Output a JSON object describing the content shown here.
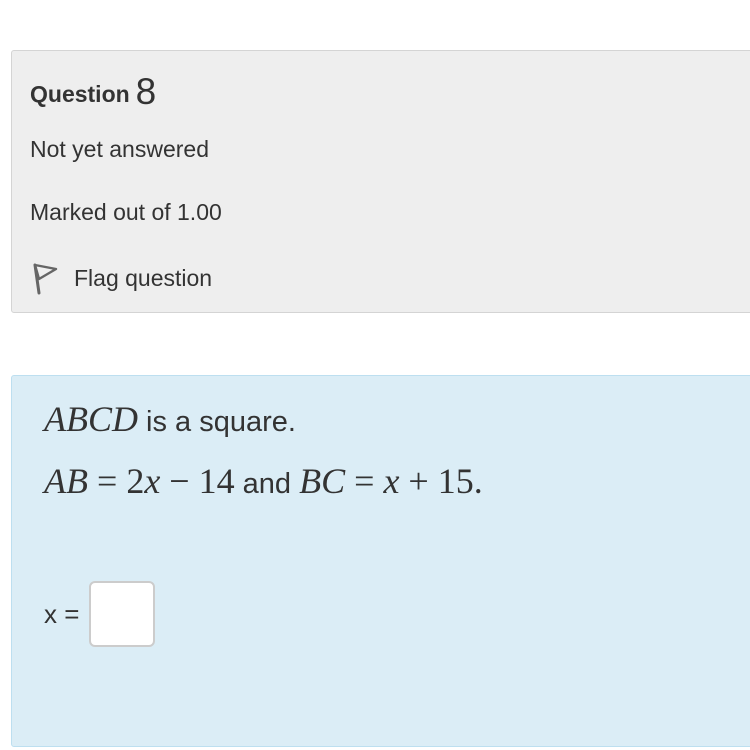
{
  "info": {
    "question_label": "Question",
    "question_number": "8",
    "state": "Not yet answered",
    "grade": "Marked out of 1.00",
    "flag_label": "Flag question",
    "flag_icon": "flag-icon"
  },
  "question": {
    "line1_math": "ABCD",
    "line1_text": " is a square.",
    "line2_part1": "AB = 2x − 14",
    "line2_and": " and ",
    "line2_part2": "BC = x + 15."
  },
  "answer": {
    "label": "x =",
    "value": ""
  },
  "colors": {
    "info_background": "#eeeeee",
    "content_background": "#dbedf6",
    "content_border": "#bddff0",
    "text": "#333333"
  }
}
